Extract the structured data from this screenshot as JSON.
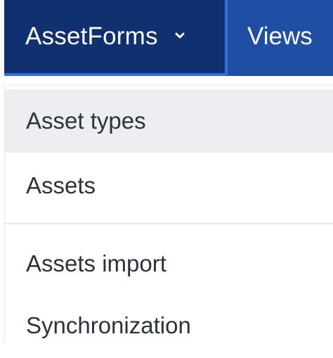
{
  "navbar": {
    "active_menu_label": "AssetForms",
    "active_menu_icon": "chevron-down-icon",
    "views_label": "Views",
    "colors": {
      "bar": "#1f4fa5",
      "active_item": "#10306f",
      "active_border": "#2f6fd6",
      "text": "#ffffff"
    }
  },
  "dropdown": {
    "items": [
      {
        "label": "Asset types",
        "highlighted": true
      },
      {
        "label": "Assets"
      },
      {
        "label": "Assets import"
      },
      {
        "label": "Synchronization"
      }
    ],
    "colors": {
      "text": "#2c333d",
      "highlight": "#eceef1",
      "divider": "#e6e8ec"
    }
  }
}
